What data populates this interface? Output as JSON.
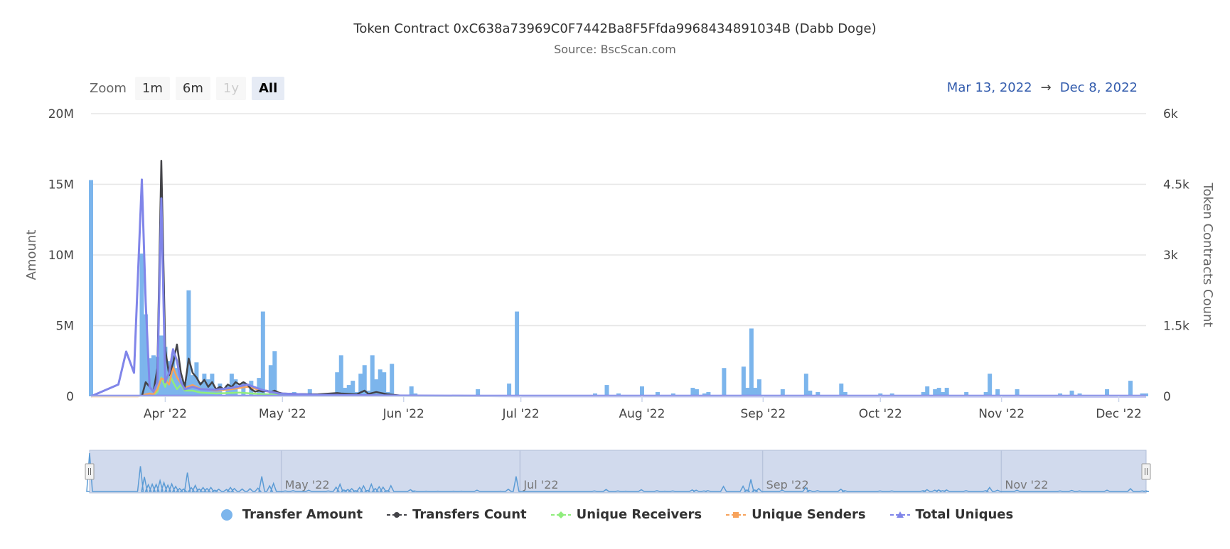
{
  "header": {
    "title": "Token Contract 0xC638a73969C0F7442Ba8F5Ffda9968434891034B (Dabb Doge)",
    "subtitle": "Source: BscScan.com"
  },
  "zoom": {
    "label": "Zoom",
    "buttons": [
      {
        "label": "1m",
        "state": "normal"
      },
      {
        "label": "6m",
        "state": "normal"
      },
      {
        "label": "1y",
        "state": "disabled"
      },
      {
        "label": "All",
        "state": "active"
      }
    ]
  },
  "range": {
    "from": "Mar 13, 2022",
    "arrow": "→",
    "to": "Dec 8, 2022"
  },
  "colors": {
    "transfer_amount": "#7cb5ec",
    "transfers_count": "#434348",
    "unique_receivers": "#90ed7d",
    "unique_senders": "#f7a35c",
    "total_uniques": "#8085e9",
    "navigator_fill": "#ccd6eb",
    "grid": "#e6e6e6"
  },
  "chart_data": {
    "type": "bar",
    "title": "Token Contract 0xC638a73969C0F7442Ba8F5Ffda9968434891034B (Dabb Doge)",
    "subtitle": "Source: BscScan.com",
    "x_start": "2022-03-13",
    "x_end": "2022-12-08",
    "x_ticks": [
      {
        "label": "Apr '22",
        "date": "2022-04-01"
      },
      {
        "label": "May '22",
        "date": "2022-05-01"
      },
      {
        "label": "Jun '22",
        "date": "2022-06-01"
      },
      {
        "label": "Jul '22",
        "date": "2022-07-01"
      },
      {
        "label": "Aug '22",
        "date": "2022-08-01"
      },
      {
        "label": "Sep '22",
        "date": "2022-09-01"
      },
      {
        "label": "Oct '22",
        "date": "2022-10-01"
      },
      {
        "label": "Nov '22",
        "date": "2022-11-01"
      },
      {
        "label": "Dec '22",
        "date": "2022-12-01"
      }
    ],
    "navigator_ticks": [
      {
        "label": "May '22",
        "date": "2022-05-01"
      },
      {
        "label": "Jul '22",
        "date": "2022-07-01"
      },
      {
        "label": "Sep '22",
        "date": "2022-09-01"
      },
      {
        "label": "Nov '22",
        "date": "2022-11-01"
      }
    ],
    "y_left": {
      "label": "Amount",
      "ylim": [
        0,
        20000000
      ],
      "ticks": [
        {
          "value": 0,
          "label": "0"
        },
        {
          "value": 5000000,
          "label": "5M"
        },
        {
          "value": 10000000,
          "label": "10M"
        },
        {
          "value": 15000000,
          "label": "15M"
        },
        {
          "value": 20000000,
          "label": "20M"
        }
      ]
    },
    "y_right": {
      "label": "Token Contracts Count",
      "ylim": [
        0,
        6000
      ],
      "ticks": [
        {
          "value": 0,
          "label": "0"
        },
        {
          "value": 1500,
          "label": "1.5k"
        },
        {
          "value": 3000,
          "label": "3k"
        },
        {
          "value": 4500,
          "label": "4.5k"
        },
        {
          "value": 6000,
          "label": "6k"
        }
      ]
    },
    "grid": true,
    "legend_position": "bottom",
    "series": [
      {
        "name": "Transfer Amount",
        "type": "column",
        "axis": "left",
        "points": [
          [
            "2022-03-13",
            15300000
          ],
          [
            "2022-03-26",
            10100000
          ],
          [
            "2022-03-27",
            5800000
          ],
          [
            "2022-03-28",
            2700000
          ],
          [
            "2022-03-29",
            2900000
          ],
          [
            "2022-03-30",
            2800000
          ],
          [
            "2022-03-31",
            4300000
          ],
          [
            "2022-04-01",
            3500000
          ],
          [
            "2022-04-02",
            2500000
          ],
          [
            "2022-04-03",
            3000000
          ],
          [
            "2022-04-04",
            2000000
          ],
          [
            "2022-04-05",
            1200000
          ],
          [
            "2022-04-06",
            1000000
          ],
          [
            "2022-04-07",
            7500000
          ],
          [
            "2022-04-08",
            1500000
          ],
          [
            "2022-04-09",
            2400000
          ],
          [
            "2022-04-10",
            1000000
          ],
          [
            "2022-04-11",
            1600000
          ],
          [
            "2022-04-12",
            1200000
          ],
          [
            "2022-04-13",
            1600000
          ],
          [
            "2022-04-14",
            500000
          ],
          [
            "2022-04-15",
            900000
          ],
          [
            "2022-04-17",
            800000
          ],
          [
            "2022-04-18",
            1600000
          ],
          [
            "2022-04-19",
            1200000
          ],
          [
            "2022-04-21",
            1000000
          ],
          [
            "2022-04-23",
            1100000
          ],
          [
            "2022-04-25",
            1300000
          ],
          [
            "2022-04-26",
            6000000
          ],
          [
            "2022-04-28",
            2200000
          ],
          [
            "2022-04-29",
            3200000
          ],
          [
            "2022-05-02",
            200000
          ],
          [
            "2022-05-04",
            300000
          ],
          [
            "2022-05-08",
            500000
          ],
          [
            "2022-05-13",
            200000
          ],
          [
            "2022-05-15",
            1700000
          ],
          [
            "2022-05-16",
            2900000
          ],
          [
            "2022-05-17",
            600000
          ],
          [
            "2022-05-18",
            800000
          ],
          [
            "2022-05-19",
            1100000
          ],
          [
            "2022-05-20",
            300000
          ],
          [
            "2022-05-21",
            1600000
          ],
          [
            "2022-05-22",
            2200000
          ],
          [
            "2022-05-23",
            400000
          ],
          [
            "2022-05-24",
            2900000
          ],
          [
            "2022-05-25",
            1200000
          ],
          [
            "2022-05-26",
            1900000
          ],
          [
            "2022-05-27",
            1700000
          ],
          [
            "2022-05-28",
            300000
          ],
          [
            "2022-05-29",
            2300000
          ],
          [
            "2022-06-03",
            700000
          ],
          [
            "2022-06-04",
            200000
          ],
          [
            "2022-06-07",
            100000
          ],
          [
            "2022-06-10",
            100000
          ],
          [
            "2022-06-14",
            100000
          ],
          [
            "2022-06-16",
            100000
          ],
          [
            "2022-06-20",
            500000
          ],
          [
            "2022-06-26",
            100000
          ],
          [
            "2022-06-28",
            900000
          ],
          [
            "2022-06-30",
            6000000
          ],
          [
            "2022-07-20",
            200000
          ],
          [
            "2022-07-23",
            800000
          ],
          [
            "2022-07-26",
            200000
          ],
          [
            "2022-07-28",
            100000
          ],
          [
            "2022-08-01",
            700000
          ],
          [
            "2022-08-05",
            300000
          ],
          [
            "2022-08-07",
            100000
          ],
          [
            "2022-08-09",
            200000
          ],
          [
            "2022-08-14",
            600000
          ],
          [
            "2022-08-15",
            500000
          ],
          [
            "2022-08-17",
            200000
          ],
          [
            "2022-08-18",
            300000
          ],
          [
            "2022-08-22",
            2000000
          ],
          [
            "2022-08-27",
            2100000
          ],
          [
            "2022-08-28",
            600000
          ],
          [
            "2022-08-29",
            4800000
          ],
          [
            "2022-08-30",
            600000
          ],
          [
            "2022-08-31",
            1200000
          ],
          [
            "2022-09-06",
            500000
          ],
          [
            "2022-09-12",
            1600000
          ],
          [
            "2022-09-13",
            400000
          ],
          [
            "2022-09-15",
            300000
          ],
          [
            "2022-09-21",
            900000
          ],
          [
            "2022-09-22",
            300000
          ],
          [
            "2022-10-01",
            200000
          ],
          [
            "2022-10-04",
            200000
          ],
          [
            "2022-10-12",
            300000
          ],
          [
            "2022-10-13",
            700000
          ],
          [
            "2022-10-15",
            500000
          ],
          [
            "2022-10-16",
            600000
          ],
          [
            "2022-10-17",
            300000
          ],
          [
            "2022-10-18",
            600000
          ],
          [
            "2022-10-23",
            300000
          ],
          [
            "2022-10-28",
            300000
          ],
          [
            "2022-10-29",
            1600000
          ],
          [
            "2022-10-31",
            500000
          ],
          [
            "2022-11-05",
            500000
          ],
          [
            "2022-11-16",
            200000
          ],
          [
            "2022-11-19",
            400000
          ],
          [
            "2022-11-21",
            200000
          ],
          [
            "2022-11-28",
            500000
          ],
          [
            "2022-12-04",
            1100000
          ],
          [
            "2022-12-07",
            200000
          ],
          [
            "2022-12-08",
            200000
          ]
        ]
      },
      {
        "name": "Transfers Count",
        "type": "line",
        "axis": "right",
        "points": [
          [
            "2022-03-26",
            0
          ],
          [
            "2022-03-27",
            300
          ],
          [
            "2022-03-28",
            200
          ],
          [
            "2022-03-29",
            100
          ],
          [
            "2022-03-30",
            600
          ],
          [
            "2022-03-31",
            5000
          ],
          [
            "2022-04-01",
            1000
          ],
          [
            "2022-04-02",
            450
          ],
          [
            "2022-04-03",
            700
          ],
          [
            "2022-04-04",
            1100
          ],
          [
            "2022-04-05",
            500
          ],
          [
            "2022-04-06",
            200
          ],
          [
            "2022-04-07",
            800
          ],
          [
            "2022-04-08",
            500
          ],
          [
            "2022-04-09",
            400
          ],
          [
            "2022-04-10",
            250
          ],
          [
            "2022-04-11",
            350
          ],
          [
            "2022-04-12",
            200
          ],
          [
            "2022-04-13",
            300
          ],
          [
            "2022-04-14",
            150
          ],
          [
            "2022-04-15",
            200
          ],
          [
            "2022-04-16",
            150
          ],
          [
            "2022-04-17",
            250
          ],
          [
            "2022-04-18",
            200
          ],
          [
            "2022-04-19",
            300
          ],
          [
            "2022-04-20",
            250
          ],
          [
            "2022-04-21",
            300
          ],
          [
            "2022-04-22",
            250
          ],
          [
            "2022-04-23",
            150
          ],
          [
            "2022-04-24",
            100
          ],
          [
            "2022-04-25",
            120
          ],
          [
            "2022-04-26",
            100
          ],
          [
            "2022-04-27",
            120
          ],
          [
            "2022-04-28",
            90
          ],
          [
            "2022-04-29",
            120
          ],
          [
            "2022-04-30",
            80
          ],
          [
            "2022-05-01",
            60
          ],
          [
            "2022-05-05",
            50
          ],
          [
            "2022-05-10",
            40
          ],
          [
            "2022-05-15",
            70
          ],
          [
            "2022-05-16",
            60
          ],
          [
            "2022-05-20",
            40
          ],
          [
            "2022-05-22",
            120
          ],
          [
            "2022-05-23",
            50
          ],
          [
            "2022-05-25",
            90
          ],
          [
            "2022-05-28",
            40
          ],
          [
            "2022-05-31",
            20
          ]
        ]
      },
      {
        "name": "Unique Receivers",
        "type": "line",
        "axis": "right",
        "points": [
          [
            "2022-03-29",
            20
          ],
          [
            "2022-03-30",
            100
          ],
          [
            "2022-03-31",
            400
          ],
          [
            "2022-04-01",
            200
          ],
          [
            "2022-04-02",
            500
          ],
          [
            "2022-04-03",
            300
          ],
          [
            "2022-04-04",
            150
          ],
          [
            "2022-04-05",
            250
          ],
          [
            "2022-04-06",
            120
          ],
          [
            "2022-04-08",
            120
          ],
          [
            "2022-04-10",
            80
          ],
          [
            "2022-04-14",
            60
          ],
          [
            "2022-04-20",
            80
          ],
          [
            "2022-04-25",
            50
          ],
          [
            "2022-04-30",
            30
          ],
          [
            "2022-05-10",
            20
          ],
          [
            "2022-05-31",
            10
          ],
          [
            "2022-06-30",
            5
          ]
        ]
      },
      {
        "name": "Unique Senders",
        "type": "line",
        "axis": "right",
        "points": [
          [
            "2022-03-13",
            0
          ],
          [
            "2022-03-25",
            0
          ],
          [
            "2022-03-28",
            60
          ],
          [
            "2022-03-29",
            40
          ],
          [
            "2022-03-30",
            150
          ],
          [
            "2022-03-31",
            380
          ],
          [
            "2022-04-01",
            350
          ],
          [
            "2022-04-02",
            250
          ],
          [
            "2022-04-03",
            620
          ],
          [
            "2022-04-04",
            400
          ],
          [
            "2022-04-05",
            280
          ],
          [
            "2022-04-06",
            180
          ],
          [
            "2022-04-08",
            240
          ],
          [
            "2022-04-10",
            160
          ],
          [
            "2022-04-14",
            120
          ],
          [
            "2022-04-18",
            150
          ],
          [
            "2022-04-22",
            200
          ],
          [
            "2022-04-26",
            120
          ],
          [
            "2022-04-30",
            60
          ],
          [
            "2022-05-10",
            30
          ],
          [
            "2022-05-31",
            15
          ],
          [
            "2022-06-30",
            5
          ]
        ]
      },
      {
        "name": "Total Uniques",
        "type": "line",
        "axis": "right",
        "points": [
          [
            "2022-03-13",
            0
          ],
          [
            "2022-03-20",
            250
          ],
          [
            "2022-03-22",
            950
          ],
          [
            "2022-03-24",
            500
          ],
          [
            "2022-03-26",
            4600
          ],
          [
            "2022-03-27",
            2000
          ],
          [
            "2022-03-28",
            200
          ],
          [
            "2022-03-29",
            100
          ],
          [
            "2022-03-30",
            300
          ],
          [
            "2022-03-31",
            4200
          ],
          [
            "2022-04-01",
            300
          ],
          [
            "2022-04-02",
            500
          ],
          [
            "2022-04-03",
            1000
          ],
          [
            "2022-04-04",
            750
          ],
          [
            "2022-04-05",
            300
          ],
          [
            "2022-04-06",
            150
          ],
          [
            "2022-04-08",
            200
          ],
          [
            "2022-04-10",
            150
          ],
          [
            "2022-04-14",
            140
          ],
          [
            "2022-04-18",
            180
          ],
          [
            "2022-04-22",
            250
          ],
          [
            "2022-04-26",
            130
          ],
          [
            "2022-04-30",
            60
          ],
          [
            "2022-05-10",
            30
          ],
          [
            "2022-05-31",
            15
          ],
          [
            "2022-06-30",
            5
          ],
          [
            "2022-12-08",
            0
          ]
        ]
      }
    ]
  },
  "legend": [
    {
      "label": "Transfer Amount",
      "symbol": "circle"
    },
    {
      "label": "Transfers Count",
      "symbol": "line-circle"
    },
    {
      "label": "Unique Receivers",
      "symbol": "line-diamond"
    },
    {
      "label": "Unique Senders",
      "symbol": "line-square"
    },
    {
      "label": "Total Uniques",
      "symbol": "line-triangle"
    }
  ]
}
